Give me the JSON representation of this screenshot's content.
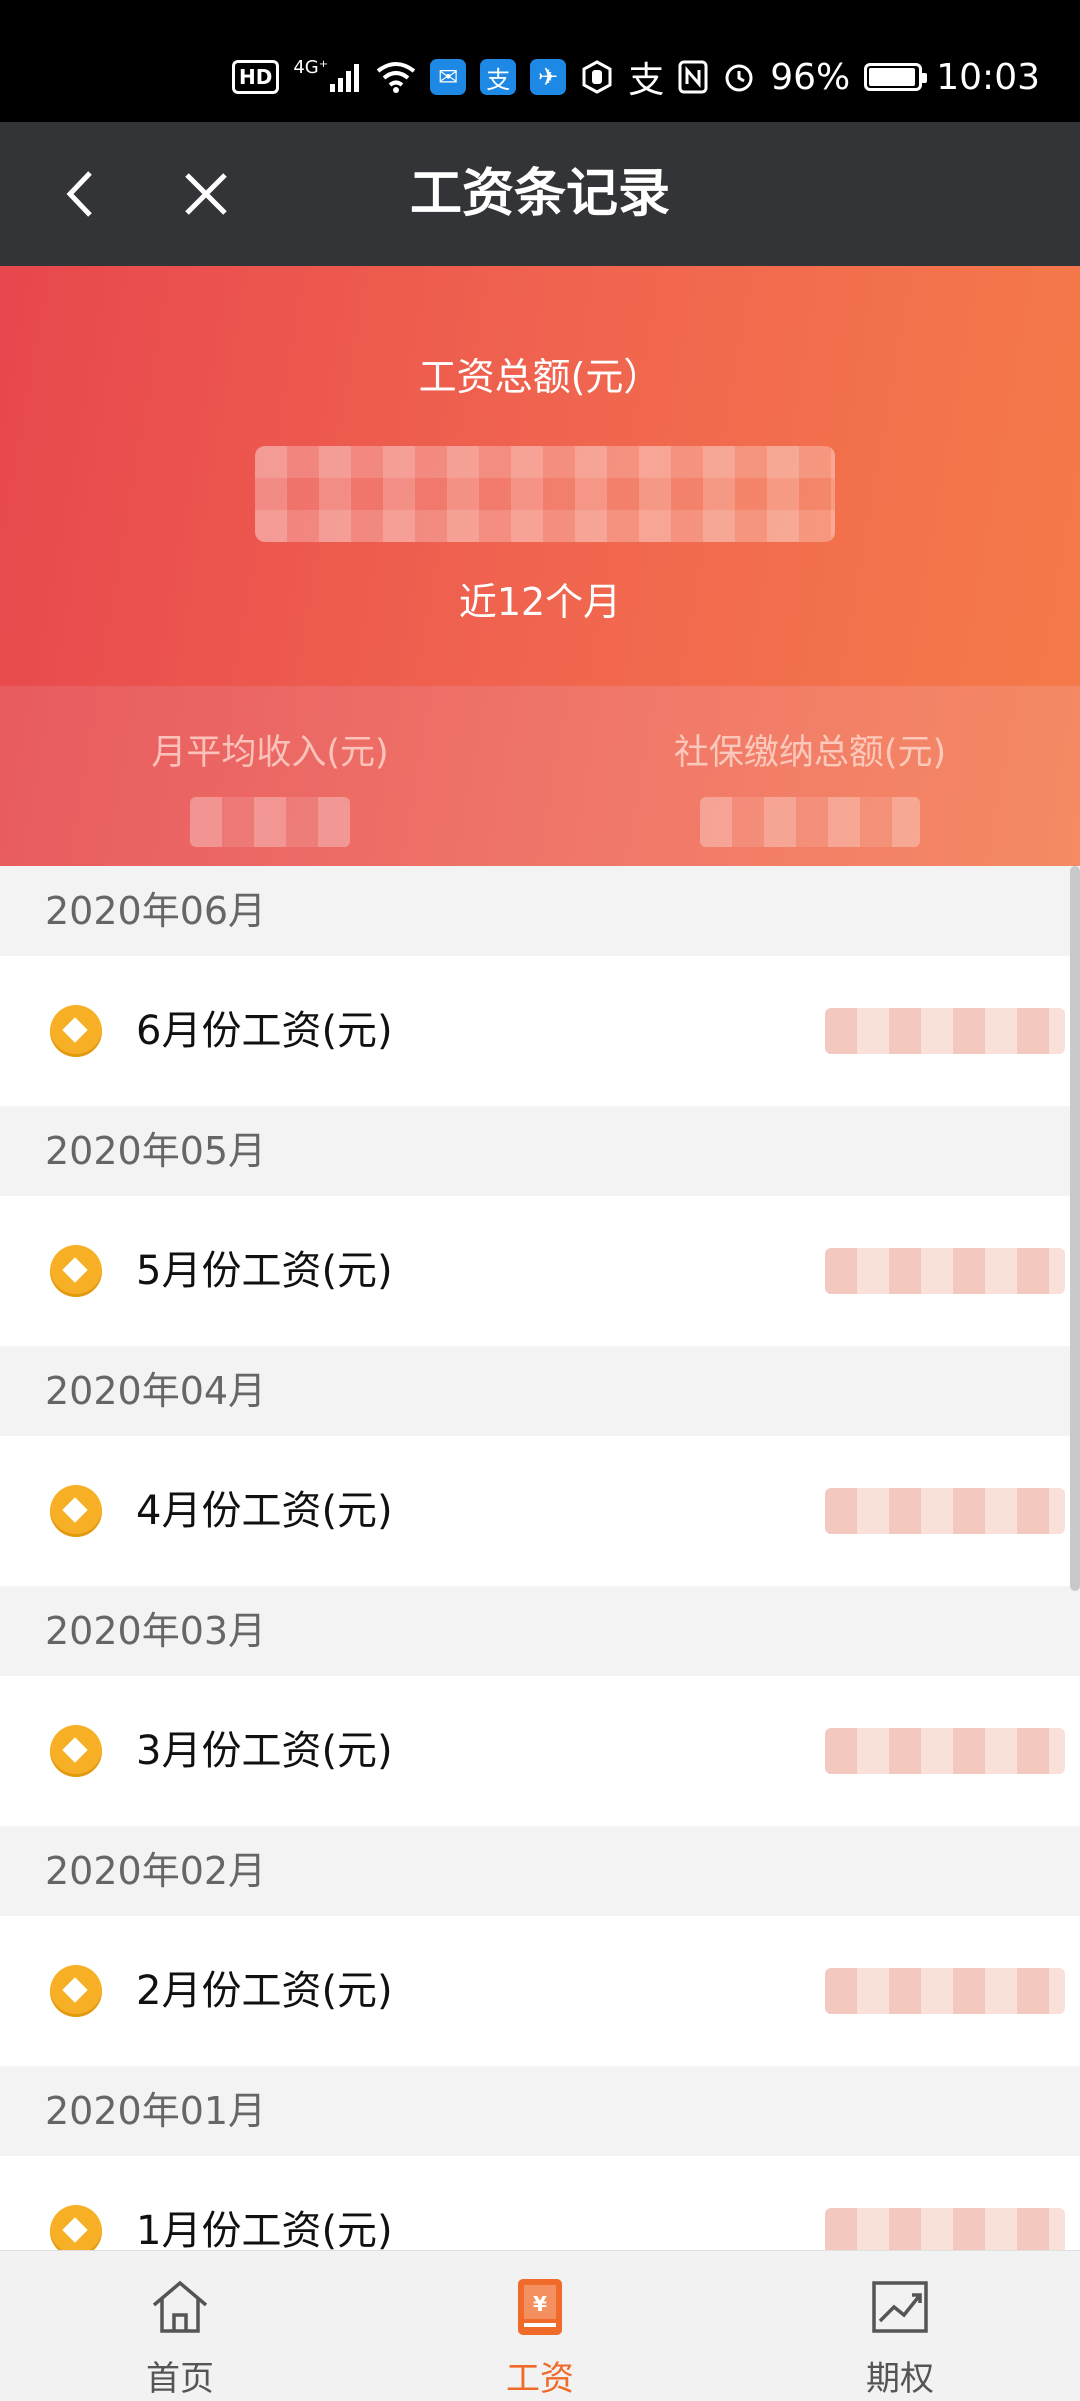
{
  "status_bar": {
    "network": "4G⁺",
    "battery": "96%",
    "time": "10:03",
    "hd": "HD",
    "alipay_char": "支"
  },
  "title_bar": {
    "title": "工资条记录"
  },
  "summary": {
    "total_label": "工资总额(元）",
    "period_label": "近12个月",
    "avg_income_label": "月平均收入(元)",
    "social_security_label": "社保缴纳总额(元)"
  },
  "records": [
    {
      "month_header": "2020年06月",
      "label": "6月份工资(元)"
    },
    {
      "month_header": "2020年05月",
      "label": "5月份工资(元)"
    },
    {
      "month_header": "2020年04月",
      "label": "4月份工资(元)"
    },
    {
      "month_header": "2020年03月",
      "label": "3月份工资(元)"
    },
    {
      "month_header": "2020年02月",
      "label": "2月份工资(元)"
    },
    {
      "month_header": "2020年01月",
      "label": "1月份工资(元)"
    }
  ],
  "bottom_nav": [
    {
      "label": "首页",
      "icon": "home-icon",
      "active": false
    },
    {
      "label": "工资",
      "icon": "salary-icon",
      "active": true
    },
    {
      "label": "期权",
      "icon": "chart-icon",
      "active": false
    }
  ],
  "colors": {
    "accent": "#f06a2a",
    "hero_start": "#e8474d",
    "hero_end": "#f57a4a",
    "titlebar": "#333437"
  }
}
